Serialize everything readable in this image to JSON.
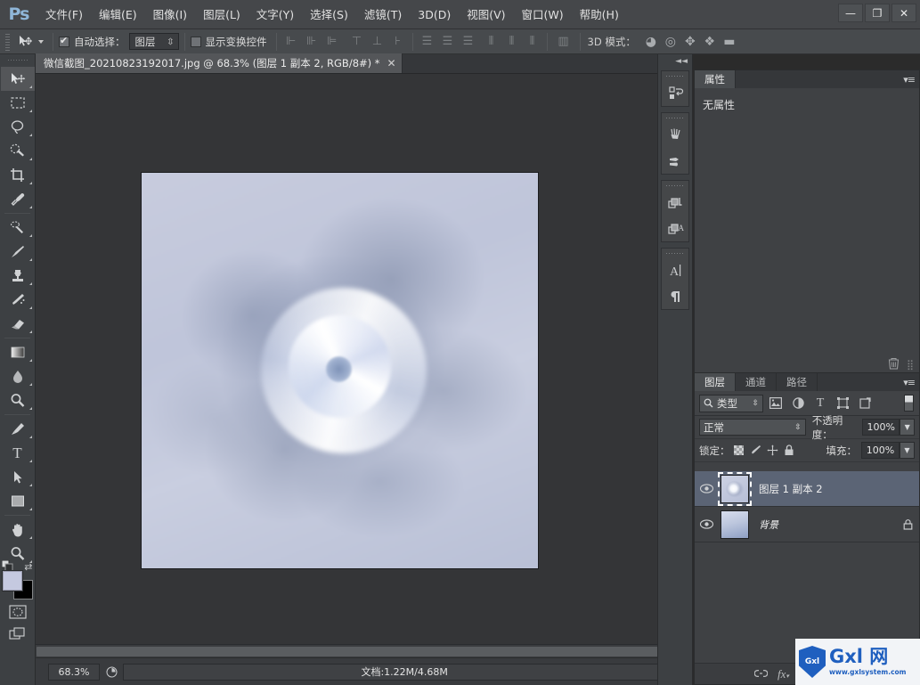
{
  "app": {
    "logo": "Ps",
    "menus": [
      {
        "label": "文件(F)"
      },
      {
        "label": "编辑(E)"
      },
      {
        "label": "图像(I)"
      },
      {
        "label": "图层(L)"
      },
      {
        "label": "文字(Y)"
      },
      {
        "label": "选择(S)"
      },
      {
        "label": "滤镜(T)"
      },
      {
        "label": "3D(D)"
      },
      {
        "label": "视图(V)"
      },
      {
        "label": "窗口(W)"
      },
      {
        "label": "帮助(H)"
      }
    ],
    "window_controls": {
      "minimize": "—",
      "maximize": "❐",
      "close": "✕"
    }
  },
  "options_bar": {
    "tool_icon": "move-tool-icon",
    "auto_select_label": "自动选择：",
    "auto_select_checked": true,
    "auto_select_value": "图层",
    "show_transform_label": "显示变换控件",
    "show_transform_checked": false,
    "align_icons": [
      "align-left-edges",
      "align-horizontal-centers",
      "align-right-edges",
      "align-top-edges",
      "align-vertical-centers",
      "align-bottom-edges"
    ],
    "distribute_icons": [
      "distribute-top-edges",
      "distribute-vertical-centers",
      "distribute-bottom-edges",
      "distribute-left-edges",
      "distribute-horizontal-centers",
      "distribute-right-edges"
    ],
    "auto_align_icon": "auto-align-layers",
    "mode_3d_label": "3D 模式：",
    "mode_3d_icons": [
      "rotate-3d-object",
      "roll-3d-object",
      "drag-3d-object",
      "slide-3d-object",
      "scale-3d-object"
    ]
  },
  "document_tab": {
    "title": "微信截图_20210823192017.jpg @ 68.3% (图层 1 副本 2, RGB/8#) *",
    "close": "✕"
  },
  "toolbar": {
    "tools": [
      {
        "name": "move-tool",
        "glyph": "✥",
        "active": true
      },
      {
        "name": "rectangular-marquee-tool",
        "glyph": "▭"
      },
      {
        "name": "lasso-tool",
        "glyph": "◯"
      },
      {
        "name": "quick-selection-tool",
        "glyph": "❂"
      },
      {
        "name": "crop-tool",
        "glyph": "⌗"
      },
      {
        "name": "eyedropper-tool",
        "glyph": "⚲"
      },
      {
        "name": "spot-healing-brush-tool",
        "glyph": "✎"
      },
      {
        "name": "brush-tool",
        "glyph": "🖌"
      },
      {
        "name": "clone-stamp-tool",
        "glyph": "⚒"
      },
      {
        "name": "history-brush-tool",
        "glyph": "✐"
      },
      {
        "name": "eraser-tool",
        "glyph": "▰"
      },
      {
        "name": "gradient-tool",
        "glyph": "▤"
      },
      {
        "name": "blur-tool",
        "glyph": "◗"
      },
      {
        "name": "dodge-tool",
        "glyph": "◍"
      },
      {
        "name": "pen-tool",
        "glyph": "✒"
      },
      {
        "name": "horizontal-type-tool",
        "glyph": "T"
      },
      {
        "name": "path-selection-tool",
        "glyph": "➤"
      },
      {
        "name": "rectangle-tool",
        "glyph": "▢"
      },
      {
        "name": "hand-tool",
        "glyph": "✋"
      },
      {
        "name": "zoom-tool",
        "glyph": "🔍"
      }
    ],
    "default_colors_icon": "default-foreground-background-icon",
    "swap_colors_icon": "swap-colors-icon",
    "foreground_color": "#c5c9e0",
    "background_color": "#000000",
    "quick_mask_icon": "quick-mask-mode-icon",
    "screen_mode_icon": "screen-mode-icon"
  },
  "icon_rail": {
    "collapse": "◄◄",
    "groups": [
      {
        "icons": [
          {
            "name": "history-panel-icon",
            "glyph": "↺"
          }
        ]
      },
      {
        "icons": [
          {
            "name": "brush-presets-icon",
            "glyph": "🖌"
          },
          {
            "name": "brush-panel-icon",
            "glyph": "✒"
          }
        ]
      },
      {
        "icons": [
          {
            "name": "layer-comps-icon",
            "glyph": "⧉"
          },
          {
            "name": "character-styles-icon",
            "glyph": "A"
          }
        ]
      },
      {
        "icons": [
          {
            "name": "character-panel-icon",
            "glyph": "A"
          },
          {
            "name": "paragraph-panel-icon",
            "glyph": "¶"
          }
        ]
      }
    ]
  },
  "properties_panel": {
    "tabs": [
      {
        "label": "属性",
        "active": true
      }
    ],
    "menu_icon": "panel-menu-icon",
    "body_text": "无属性",
    "footer_icons": [
      "delete-properties-icon"
    ]
  },
  "layers_panel": {
    "tabs": [
      {
        "label": "图层",
        "active": true
      },
      {
        "label": "通道",
        "active": false
      },
      {
        "label": "路径",
        "active": false
      }
    ],
    "menu_icon": "panel-menu-icon",
    "filter": {
      "search_icon": "search-icon",
      "type_label": "类型",
      "filter_icons": [
        "filter-pixel-icon",
        "filter-adjustment-icon",
        "filter-type-icon",
        "filter-shape-icon",
        "filter-smart-object-icon"
      ],
      "toggle_name": "filter-enable-toggle"
    },
    "blend_mode_label": "正常",
    "opacity_label": "不透明度：",
    "opacity_value": "100%",
    "lock_label": "锁定：",
    "lock_icons": [
      "lock-transparent-pixels-icon",
      "lock-image-pixels-icon",
      "lock-position-icon",
      "lock-all-icon"
    ],
    "fill_label": "填充：",
    "fill_value": "100%",
    "layers": [
      {
        "name": "图层 1 副本 2",
        "visible": true,
        "selected": true,
        "locked": false,
        "italic": false
      },
      {
        "name": "背景",
        "visible": true,
        "selected": false,
        "locked": true,
        "italic": true
      }
    ],
    "footer_icons": [
      {
        "name": "link-layers-icon",
        "glyph": "⛓"
      },
      {
        "name": "layer-style-icon",
        "glyph": "fx"
      },
      {
        "name": "layer-mask-icon",
        "glyph": "◉"
      }
    ],
    "panel_gap_icons": [
      {
        "name": "delete-layer-icon",
        "glyph": "🗑"
      },
      {
        "name": "resize-grip-icon",
        "glyph": "⋰"
      }
    ]
  },
  "status_bar": {
    "zoom": "68.3%",
    "preview_icon": "preview-icon",
    "doc_info": "文档:1.22M/4.68M",
    "expand_arrow": "▶"
  },
  "canvas": {
    "artboard_name": "cloud-twirl-image",
    "background_color": "#343537"
  },
  "watermark": {
    "shield_text": "Gxl",
    "main_text": "Gxl 网",
    "sub_text": "www.gxlsystem.com",
    "color": "#1f5fbf"
  }
}
